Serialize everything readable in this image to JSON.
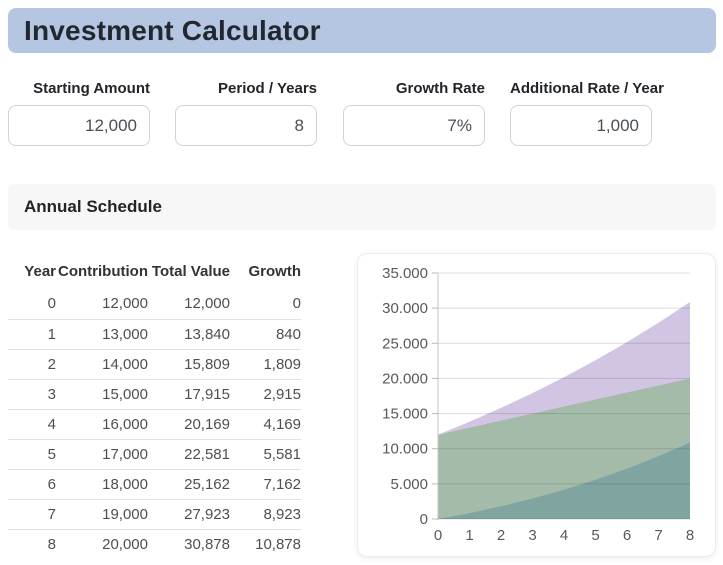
{
  "header": {
    "title": "Investment Calculator"
  },
  "inputs": [
    {
      "label": "Starting Amount",
      "value": "12,000"
    },
    {
      "label": "Period / Years",
      "value": "8"
    },
    {
      "label": "Growth Rate",
      "value": "7%"
    },
    {
      "label": "Additional Rate / Year",
      "value": "1,000"
    }
  ],
  "schedule": {
    "section_title": "Annual Schedule",
    "columns": [
      "Year",
      "Contribution",
      "Total Value",
      "Growth"
    ],
    "rows": [
      [
        "0",
        "12,000",
        "12,000",
        "0"
      ],
      [
        "1",
        "13,000",
        "13,840",
        "840"
      ],
      [
        "2",
        "14,000",
        "15,809",
        "1,809"
      ],
      [
        "3",
        "15,000",
        "17,915",
        "2,915"
      ],
      [
        "4",
        "16,000",
        "20,169",
        "4,169"
      ],
      [
        "5",
        "17,000",
        "22,581",
        "5,581"
      ],
      [
        "6",
        "18,000",
        "25,162",
        "7,162"
      ],
      [
        "7",
        "19,000",
        "27,923",
        "8,923"
      ],
      [
        "8",
        "20,000",
        "30,878",
        "10,878"
      ]
    ]
  },
  "chart_data": {
    "type": "area",
    "x": [
      0,
      1,
      2,
      3,
      4,
      5,
      6,
      7,
      8
    ],
    "series": [
      {
        "name": "Total Value",
        "values": [
          12000,
          13840,
          15809,
          17915,
          20169,
          22581,
          25162,
          27923,
          30878
        ],
        "color": "#d2c5e3"
      },
      {
        "name": "Contribution",
        "values": [
          12000,
          13000,
          14000,
          15000,
          16000,
          17000,
          18000,
          19000,
          20000
        ],
        "color": "#a5bba9"
      },
      {
        "name": "Growth",
        "values": [
          0,
          840,
          1809,
          2915,
          4169,
          5581,
          7162,
          8923,
          10878
        ],
        "color": "#80a5a0"
      }
    ],
    "ylim": [
      0,
      35000
    ],
    "ytick_step": 5000,
    "ytick_labels": [
      "0",
      "5.000",
      "10.000",
      "15.000",
      "20.000",
      "25.000",
      "30.000",
      "35.000"
    ],
    "xtick_labels": [
      "0",
      "1",
      "2",
      "3",
      "4",
      "5",
      "6",
      "7",
      "8"
    ],
    "grid": true,
    "legend": "none",
    "note": "overlapping translucent areas; colors listed are the visible flattened band colors"
  },
  "colors": {
    "title_bar_bg": "#b4c6e2",
    "section_bar_bg": "#f7f7f8",
    "area_total": "#d2c5e3",
    "area_contribution": "#a5bba9",
    "area_growth": "#80a5a0",
    "divider": "#dee2e6"
  }
}
